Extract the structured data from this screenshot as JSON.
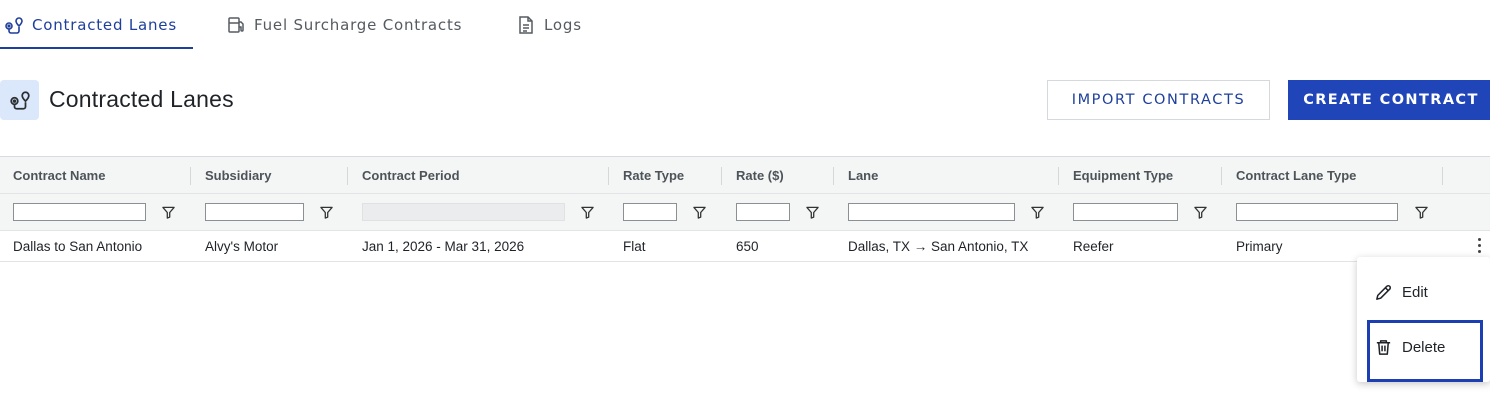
{
  "tabs": [
    {
      "label": "Contracted Lanes",
      "active": true
    },
    {
      "label": "Fuel Surcharge Contracts",
      "active": false
    },
    {
      "label": "Logs",
      "active": false
    }
  ],
  "header": {
    "title": "Contracted Lanes",
    "import_label": "IMPORT CONTRACTS",
    "create_label": "CREATE CONTRACT"
  },
  "grid": {
    "columns": [
      "Contract Name",
      "Subsidiary",
      "Contract Period",
      "Rate Type",
      "Rate ($)",
      "Lane",
      "Equipment Type",
      "Contract Lane Type"
    ],
    "rows": [
      {
        "contract_name": "Dallas to San Antonio",
        "subsidiary": "Alvy's Motor",
        "contract_period": "Jan 1, 2026 - Mar 31, 2026",
        "rate_type": "Flat",
        "rate": "650",
        "lane": "Dallas, TX → San Antonio, TX",
        "equipment_type": "Reefer",
        "contract_lane_type": "Primary"
      }
    ]
  },
  "menu": {
    "edit_label": "Edit",
    "delete_label": "Delete"
  },
  "colors": {
    "accent": "#1f3f9c",
    "primary_button": "#1f45b8",
    "highlight": "#1b3fb2"
  }
}
